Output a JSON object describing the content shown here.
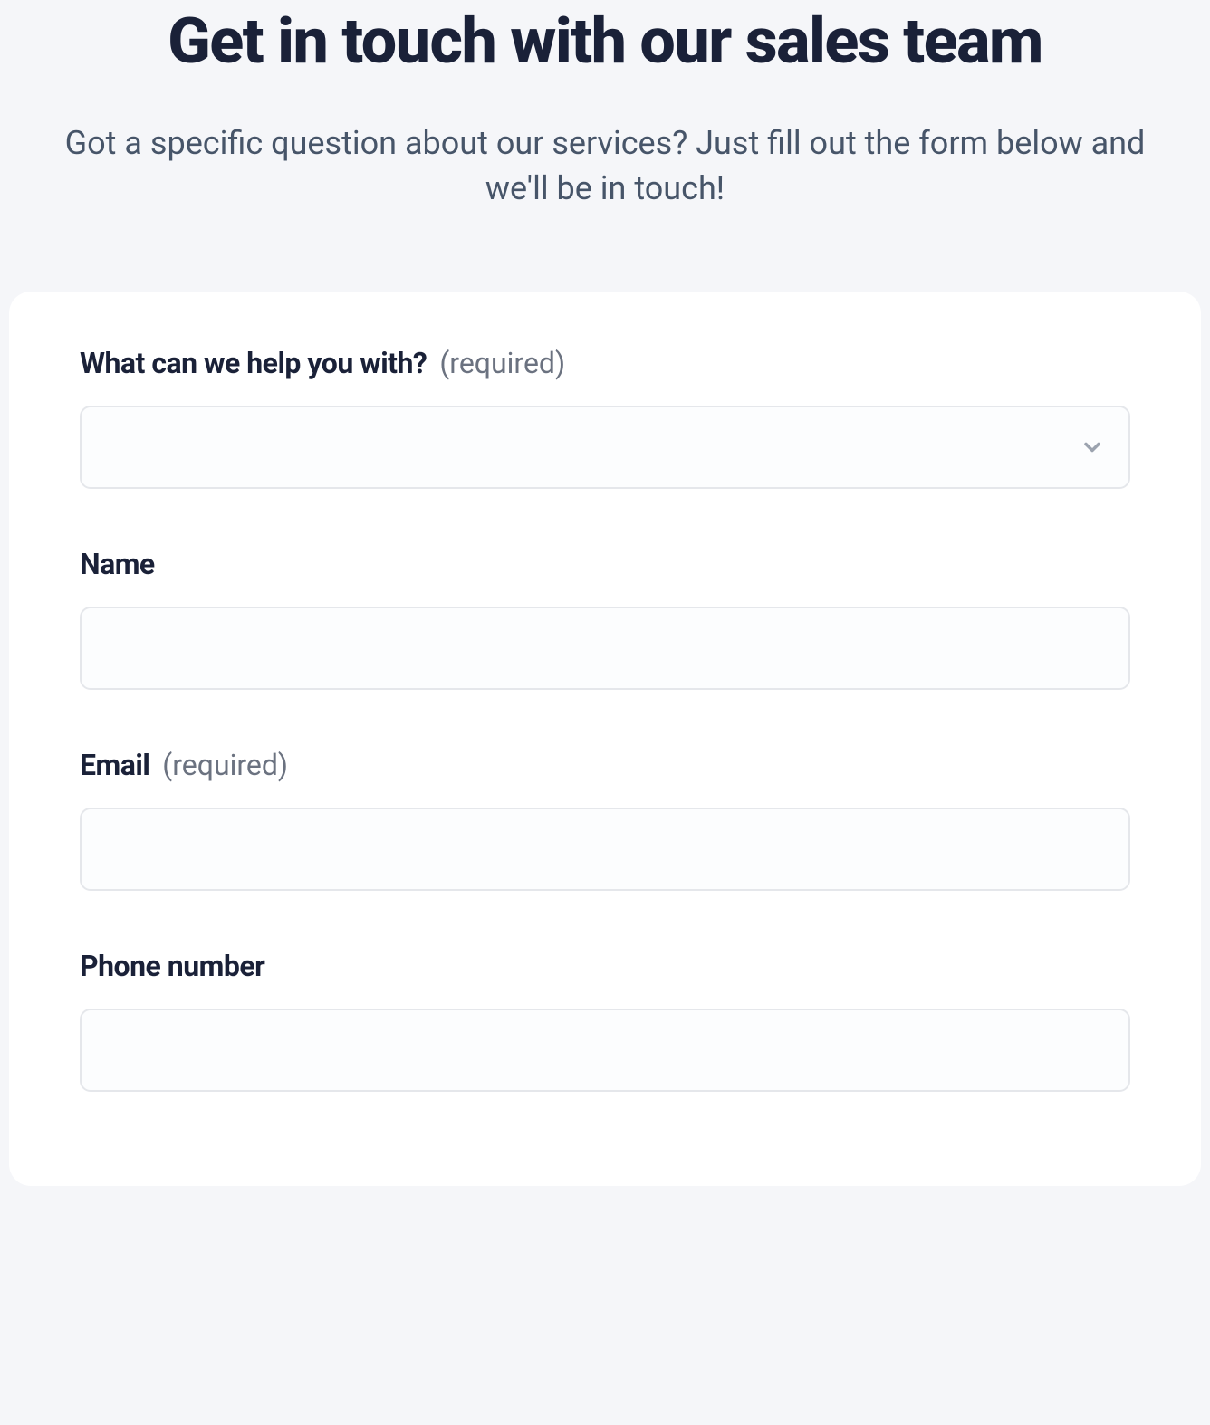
{
  "header": {
    "title": "Get in touch with our sales team",
    "subtitle": "Got a specific question about our services? Just fill out the form below and we'll be in touch!"
  },
  "form": {
    "required_tag": "(required)",
    "fields": {
      "help": {
        "label": "What can we help you with?",
        "required": true,
        "value": ""
      },
      "name": {
        "label": "Name",
        "required": false,
        "value": ""
      },
      "email": {
        "label": "Email",
        "required": true,
        "value": ""
      },
      "phone": {
        "label": "Phone number",
        "required": false,
        "value": ""
      }
    }
  }
}
